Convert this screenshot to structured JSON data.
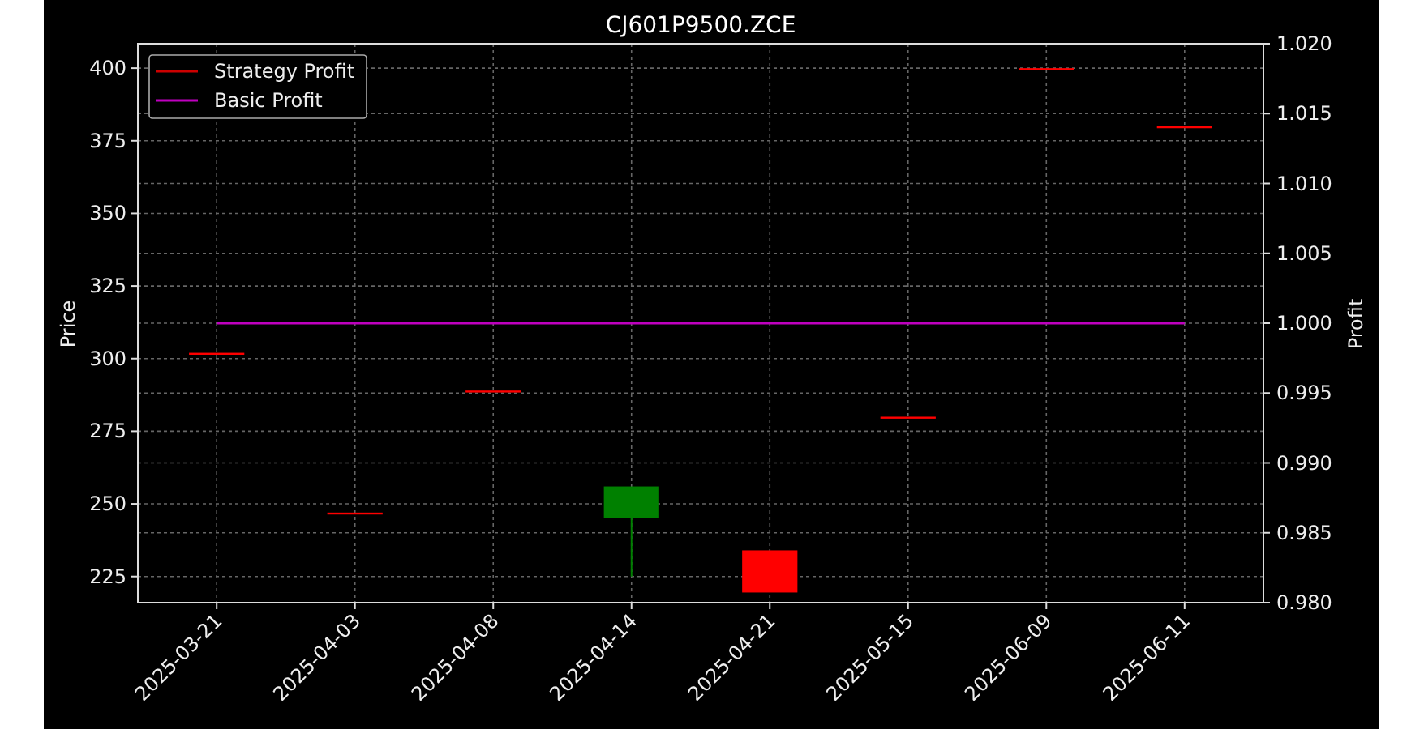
{
  "title": "CJ601P9500.ZCE",
  "chart_data": {
    "type": "candlestick",
    "categories": [
      "2025-03-21",
      "2025-04-03",
      "2025-04-08",
      "2025-04-14",
      "2025-04-21",
      "2025-05-15",
      "2025-06-09",
      "2025-06-11"
    ],
    "ylabel": "Price",
    "y2label": "Profit",
    "ylim": [
      216,
      408.4
    ],
    "yticks": [
      225,
      250,
      275,
      300,
      325,
      350,
      375,
      400
    ],
    "y2lim": [
      0.98,
      1.02
    ],
    "y2ticks": [
      {
        "value": 0.98,
        "label": "0.980"
      },
      {
        "value": 0.985,
        "label": "0.985"
      },
      {
        "value": 0.99,
        "label": "0.990"
      },
      {
        "value": 0.995,
        "label": "0.995"
      },
      {
        "value": 1.0,
        "label": "1.000"
      },
      {
        "value": 1.005,
        "label": "1.005"
      },
      {
        "value": 1.01,
        "label": "1.010"
      },
      {
        "value": 1.015,
        "label": "1.015"
      },
      {
        "value": 1.02,
        "label": "1.020"
      }
    ],
    "grid": true,
    "series": [
      {
        "ohlc": [
          [
            302,
            302,
            302,
            302
          ],
          [
            247,
            247,
            247,
            247
          ],
          [
            289,
            289,
            289,
            289
          ],
          [
            245,
            256,
            225,
            256
          ],
          [
            234,
            234,
            219.5,
            219.5
          ],
          [
            280,
            280,
            280,
            280
          ],
          [
            400,
            400,
            400,
            400
          ],
          [
            380,
            380,
            380,
            380
          ]
        ]
      },
      {
        "name": "Strategy Profit",
        "type": "line",
        "color": "#cc0000",
        "axis": "y2",
        "values": [
          null,
          null,
          null,
          null,
          null,
          null,
          null,
          null
        ]
      },
      {
        "name": "Basic Profit",
        "type": "line",
        "color": "#bf00bf",
        "axis": "y2",
        "values": [
          1,
          1,
          1,
          1,
          1,
          1,
          1,
          1
        ]
      }
    ]
  }
}
